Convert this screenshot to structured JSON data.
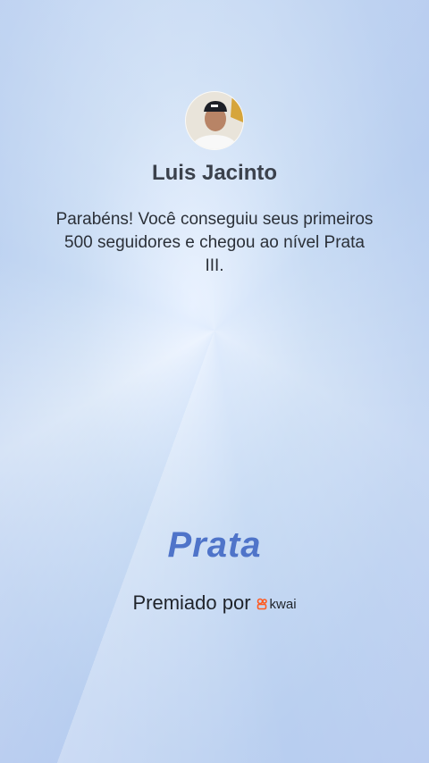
{
  "user": {
    "name": "Luis Jacinto"
  },
  "message": "Parabéns! Você conseguiu seus primeiros 500 seguidores e chegou ao nível Prata III.",
  "level": {
    "title": "Prata"
  },
  "award": {
    "prefix": "Premiado por",
    "brand_name": "kwai",
    "brand_icon": "kwai-logo-icon"
  },
  "colors": {
    "level_text": "#4f74c9",
    "brand_accent": "#ff5a1f"
  }
}
